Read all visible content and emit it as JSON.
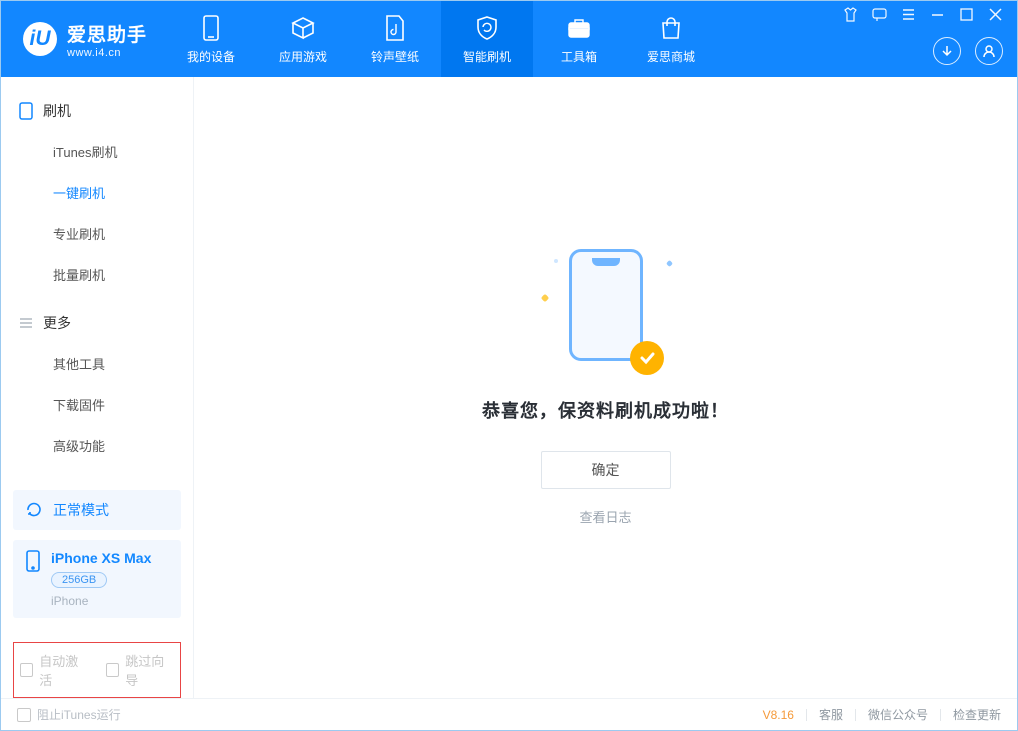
{
  "app": {
    "name_cn": "爱思助手",
    "name_en": "www.i4.cn"
  },
  "nav": {
    "device": "我的设备",
    "apps": "应用游戏",
    "ring": "铃声壁纸",
    "flash": "智能刷机",
    "toolbox": "工具箱",
    "mall": "爱思商城"
  },
  "sidebar": {
    "group_flash": "刷机",
    "items_flash": {
      "itunes": "iTunes刷机",
      "oneclick": "一键刷机",
      "pro": "专业刷机",
      "batch": "批量刷机"
    },
    "group_more": "更多",
    "items_more": {
      "other": "其他工具",
      "firmware": "下载固件",
      "advanced": "高级功能"
    },
    "mode": "正常模式",
    "device": {
      "name": "iPhone XS Max",
      "storage": "256GB",
      "type": "iPhone"
    },
    "opt_autoactivate": "自动激活",
    "opt_skipguide": "跳过向导"
  },
  "result": {
    "message": "恭喜您，保资料刷机成功啦！",
    "ok": "确定",
    "log": "查看日志"
  },
  "footer": {
    "block_itunes": "阻止iTunes运行",
    "version": "V8.16",
    "support": "客服",
    "wechat": "微信公众号",
    "update": "检查更新"
  }
}
